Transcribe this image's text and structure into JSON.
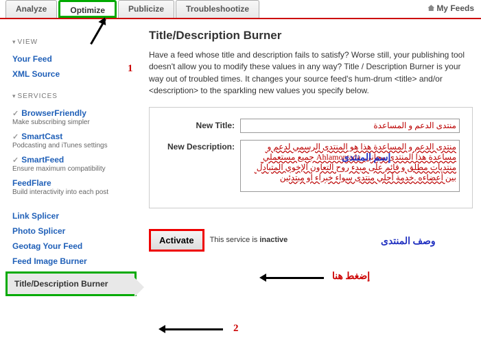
{
  "tabs": {
    "analyze": "Analyze",
    "optimize": "Optimize",
    "publicize": "Publicize",
    "troubleshootize": "Troubleshootize"
  },
  "my_feeds": "My Feeds",
  "sidebar": {
    "view_label": "VIEW",
    "your_feed": "Your Feed",
    "xml_source": "XML Source",
    "services_label": "SERVICES",
    "browserfriendly": {
      "title": "BrowserFriendly",
      "sub": "Make subscribing simpler"
    },
    "smartcast": {
      "title": "SmartCast",
      "sub": "Podcasting and iTunes settings"
    },
    "smartfeed": {
      "title": "SmartFeed",
      "sub": "Ensure maximum compatibility"
    },
    "feedflare": {
      "title": "FeedFlare",
      "sub": "Build interactivity into each post"
    },
    "linksplicer": "Link Splicer",
    "photosplicer": "Photo Splicer",
    "geotag": "Geotag Your Feed",
    "feedimage": "Feed Image Burner",
    "titledesc": "Title/Description Burner"
  },
  "content": {
    "heading": "Title/Description Burner",
    "description": "Have a feed whose title and description fails to satisfy? Worse still, your publishing tool doesn't allow you to modify these values in any way? Title / Description Burner is your way out of troubled times. It changes your source feed's hum-drum <title> and/or <description> to the sparkling new values you specify below.",
    "new_title_label": "New Title:",
    "new_title_value": "منتدى الدعم و المساعدة",
    "new_desc_label": "New Description:",
    "new_desc_value": "منتدى الدعم و المساعدة هذا هو المنتدى الرسمي لدعم و مساعدة هذا المنتدى مجاني .Ahlamontada جميع مستعملي منتديات مطلق و قائم على مبدء روح التعاون الإخوي المتبادل بين أعضاءه .خدمة أحلي منتدى سواء خبراء أو مبتدئين",
    "activate_btn": "Activate",
    "status_prefix": "This service is ",
    "status_value": "inactive"
  },
  "annotations": {
    "num1": "1",
    "num2": "2",
    "title_label_ar": "إسم المنتدى",
    "desc_label_ar": "وصف المنتدى",
    "press_here_ar": "إضغط هنا"
  }
}
